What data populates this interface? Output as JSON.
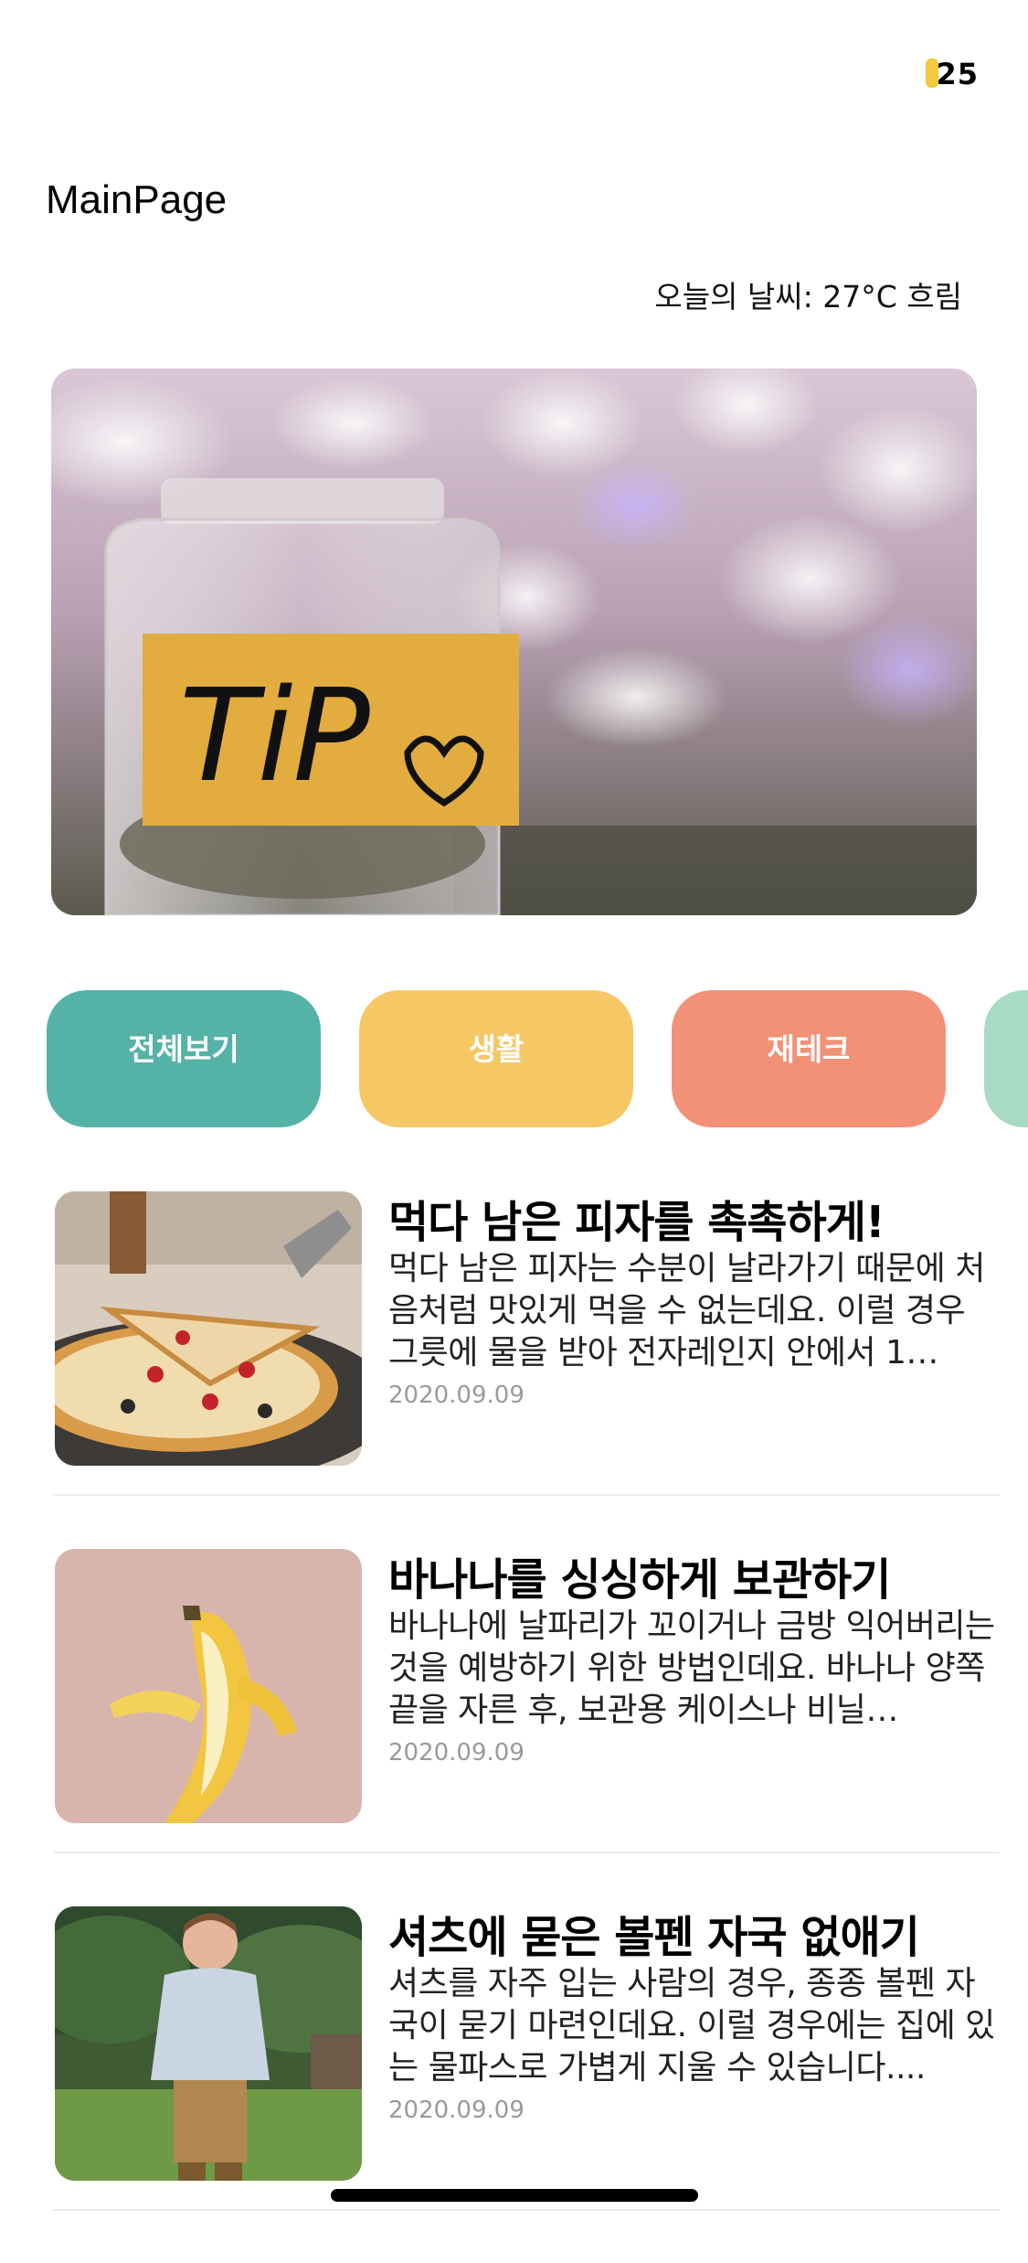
{
  "status_bar": {
    "time": "25"
  },
  "page": {
    "title": "MainPage",
    "weather": "오늘의 날씨: 27°C 흐림"
  },
  "hero": {
    "image": "tip-jar-photo",
    "label_text": "TiP"
  },
  "categories": [
    {
      "label": "전체보기",
      "color": "#55b2a6"
    },
    {
      "label": "생활",
      "color": "#f5c865"
    },
    {
      "label": "재테크",
      "color": "#f29176"
    },
    {
      "label": "",
      "color": "#a8dac6"
    }
  ],
  "articles": [
    {
      "title": "먹다 남은 피자를 촉촉하게!",
      "body": "먹다 남은 피자는 수분이 날라가기 때문에 처음처럼 맛있게 먹을 수 없는데요. 이럴 경우 그릇에 물을 받아 전자레인지 안에서 1…",
      "date": "2020.09.09",
      "thumbnail": "pizza-image"
    },
    {
      "title": "바나나를 싱싱하게 보관하기",
      "body": "바나나에 날파리가 꼬이거나 금방 익어버리는 것을 예방하기 위한 방법인데요. 바나나 양쪽 끝을 자른 후, 보관용 케이스나 비닐…",
      "date": "2020.09.09",
      "thumbnail": "banana-image"
    },
    {
      "title": "셔츠에 묻은 볼펜 자국 없애기",
      "body": "셔츠를 자주 입는 사람의 경우, 종종 볼펜 자국이 묻기 마련인데요. 이럴 경우에는 집에 있는 물파스로 가볍게 지울 수 있습니다....",
      "date": "2020.09.09",
      "thumbnail": "boy-shirt-image"
    }
  ]
}
